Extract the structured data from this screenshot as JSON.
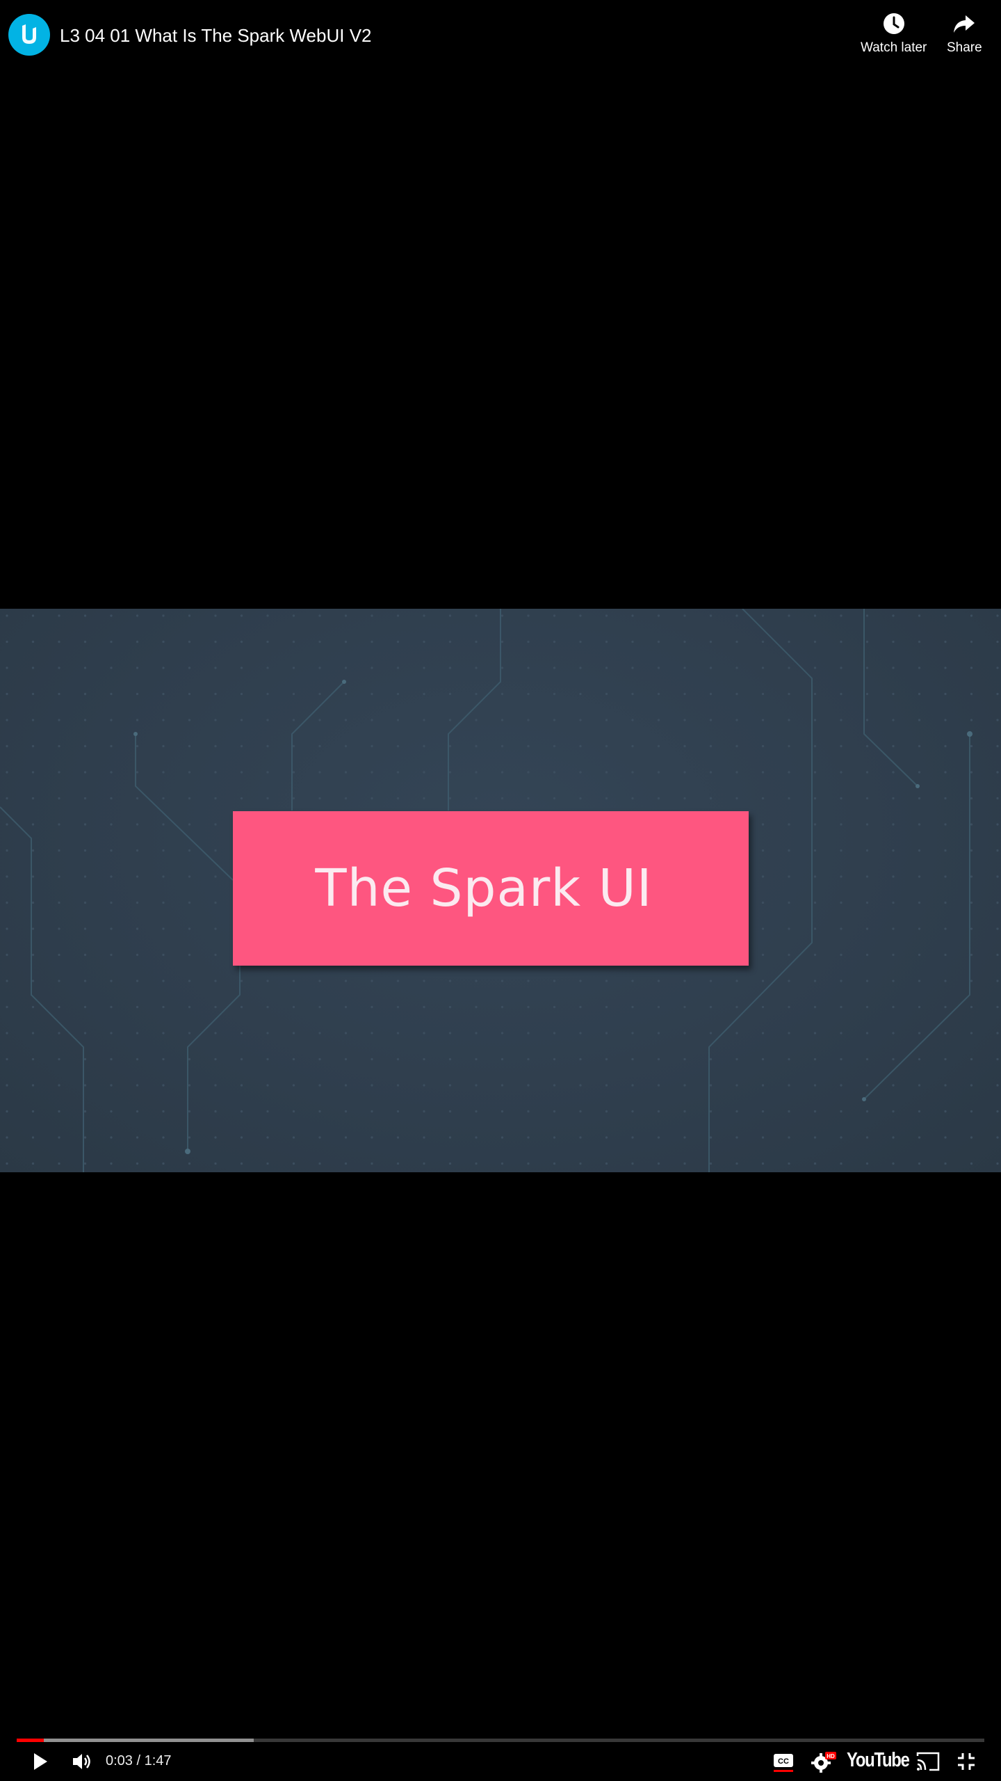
{
  "header": {
    "title": "L3 04 01 What Is The Spark WebUI V2",
    "avatar_icon": "udacity-logo-icon",
    "watch_later_label": "Watch later",
    "share_label": "Share"
  },
  "video": {
    "card_text": "The Spark UI",
    "card_color": "#fe5680",
    "background_color": "#2f3e4d"
  },
  "controls": {
    "current_time": "0:03",
    "duration": "1:47",
    "time_display": "0:03 / 1:47",
    "played_fraction": 0.028,
    "buffered_fraction": 0.245,
    "progress_color": "#ff0000",
    "brand_label": "YouTube",
    "icons": [
      "play-icon",
      "volume-icon",
      "captions-icon",
      "settings-hd-icon",
      "youtube-logo",
      "cast-icon",
      "exit-fullscreen-icon"
    ]
  }
}
